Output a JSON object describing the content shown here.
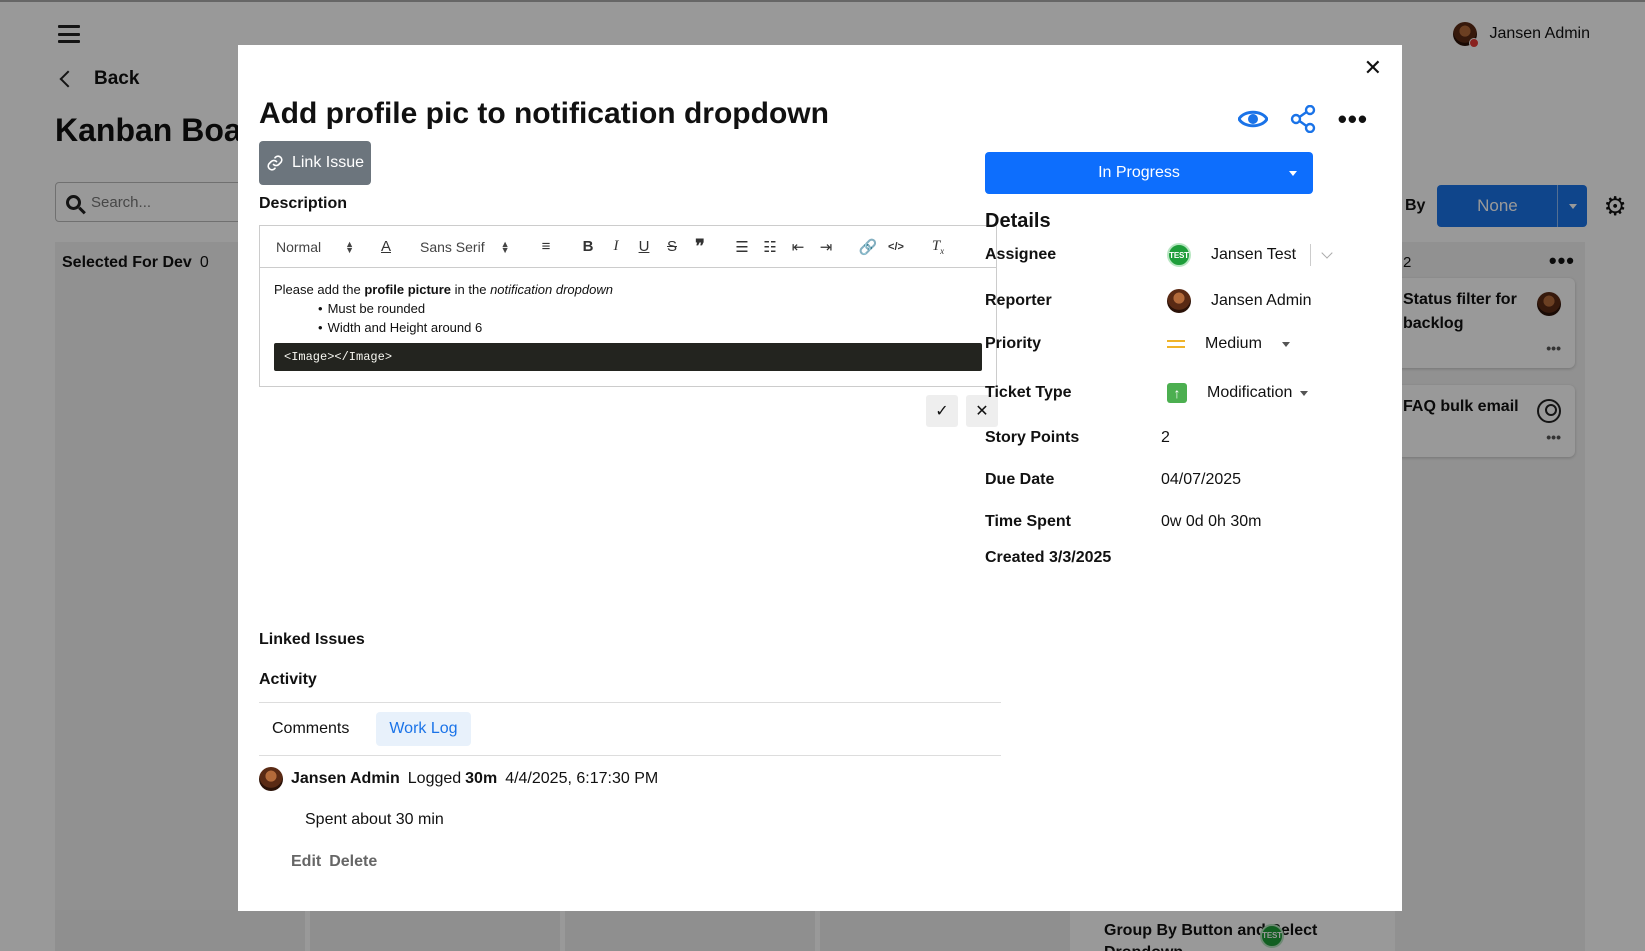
{
  "background": {
    "user_name": "Jansen Admin",
    "back_label": "Back",
    "board_title": "Kanban Board",
    "search_placeholder": "Search...",
    "column_selected": {
      "title": "Selected For Dev",
      "count": "0"
    },
    "column_right_count": "2",
    "cards": [
      {
        "title": "Status filter for backlog"
      },
      {
        "title": "FAQ bulk email"
      }
    ],
    "group_by_label": "By",
    "group_by_value": "None",
    "bottom_card": "Group By Button and Select Dropdown"
  },
  "modal": {
    "title": "Add profile pic to notification dropdown",
    "link_issue_label": "Link Issue",
    "description_label": "Description",
    "toolbar": {
      "format": "Normal",
      "font": "Sans Serif"
    },
    "description": {
      "p_pre": "Please add the ",
      "p_bold": "profile picture",
      "p_mid": " in the ",
      "p_italic": "notification dropdown",
      "bullets": [
        "Must be rounded",
        "Width and Height around 6"
      ],
      "code": "<Image></Image>"
    },
    "linked_issues_label": "Linked Issues",
    "activity_label": "Activity",
    "tabs": [
      {
        "label": "Comments"
      },
      {
        "label": "Work Log"
      }
    ],
    "log": {
      "user": "Jansen Admin",
      "action": "Logged",
      "amount": "30m",
      "date": "4/4/2025, 6:17:30 PM",
      "text": "Spent about 30 min",
      "edit": "Edit",
      "delete": "Delete"
    },
    "status": "In Progress",
    "details_heading": "Details",
    "details": {
      "assignee_label": "Assignee",
      "assignee": "Jansen Test",
      "reporter_label": "Reporter",
      "reporter": "Jansen Admin",
      "priority_label": "Priority",
      "priority": "Medium",
      "ticket_type_label": "Ticket Type",
      "ticket_type": "Modification",
      "story_points_label": "Story Points",
      "story_points": "2",
      "due_date_label": "Due Date",
      "due_date": "04/07/2025",
      "time_spent_label": "Time Spent",
      "time_spent": "0w 0d 0h 30m",
      "created": "Created 3/3/2025"
    },
    "badge_text": "TEST"
  },
  "colors": {
    "primary": "#0d6efd",
    "link_issue_bg": "#6c757d",
    "priority": "#f0b429",
    "type_icon": "#4caf50"
  }
}
